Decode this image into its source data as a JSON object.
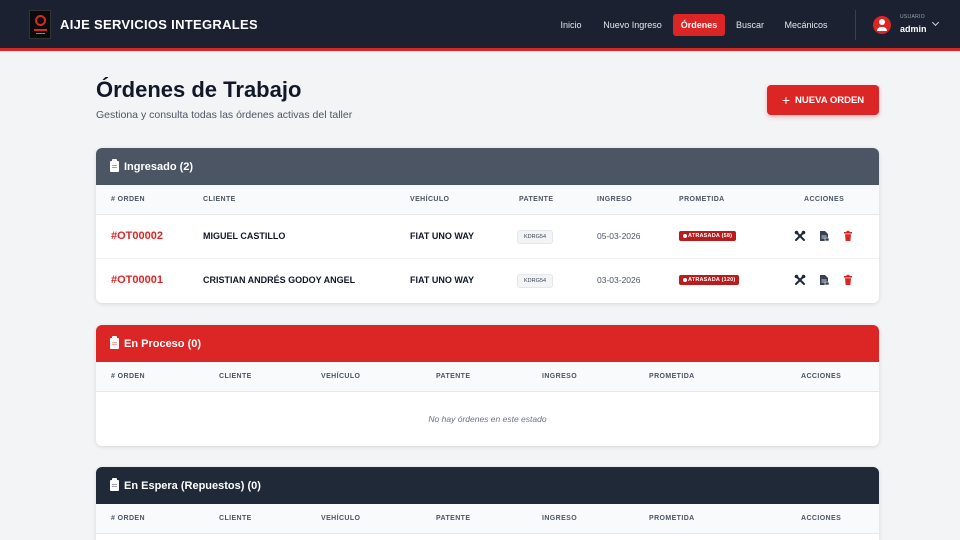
{
  "nav": {
    "brand": "AIJE SERVICIOS INTEGRALES",
    "links": [
      "Inicio",
      "Nuevo Ingreso",
      "Órdenes",
      "Buscar",
      "Mecánicos"
    ],
    "active_link": "Órdenes",
    "user_role": "USUARIO",
    "user_name": "admin"
  },
  "page": {
    "title": "Órdenes de Trabajo",
    "subtitle": "Gestiona y consulta todas las órdenes activas del taller",
    "new_order_label": "NUEVA ORDEN"
  },
  "columns": [
    "# ORDEN",
    "CLIENTE",
    "VEHÍCULO",
    "PATENTE",
    "INGRESO",
    "PROMETIDA",
    "ACCIONES"
  ],
  "sections": [
    {
      "title": "Ingresado (2)",
      "rows": [
        {
          "order": "#OT00002",
          "client": "MIGUEL CASTILLO",
          "vehicle": "FIAT UNO WAY",
          "plate": "KDRG54",
          "ingreso": "05-03-2026",
          "status": "ATRASADA (58)"
        },
        {
          "order": "#OT00001",
          "client": "CRISTIAN ANDRÉS GODOY ANGEL",
          "vehicle": "FIAT UNO WAY",
          "plate": "KDRG54",
          "ingreso": "03-03-2026",
          "status": "ATRASADA (120)"
        }
      ]
    },
    {
      "title": "En Proceso (0)",
      "empty_text": "No hay órdenes en este estado"
    },
    {
      "title": "En Espera (Repuestos) (0)"
    }
  ],
  "colors": {
    "navbar": "#1b2130",
    "accent": "#dc2626",
    "section_ingresado": "#4b5563",
    "section_proceso": "#dc2626",
    "section_espera": "#1f2937",
    "badge": "#b91c1c"
  },
  "icons": [
    "tools-icon",
    "document-icon",
    "trash-icon",
    "clipboard-icon",
    "user-circle-icon",
    "chevron-down-icon",
    "plus-icon"
  ]
}
